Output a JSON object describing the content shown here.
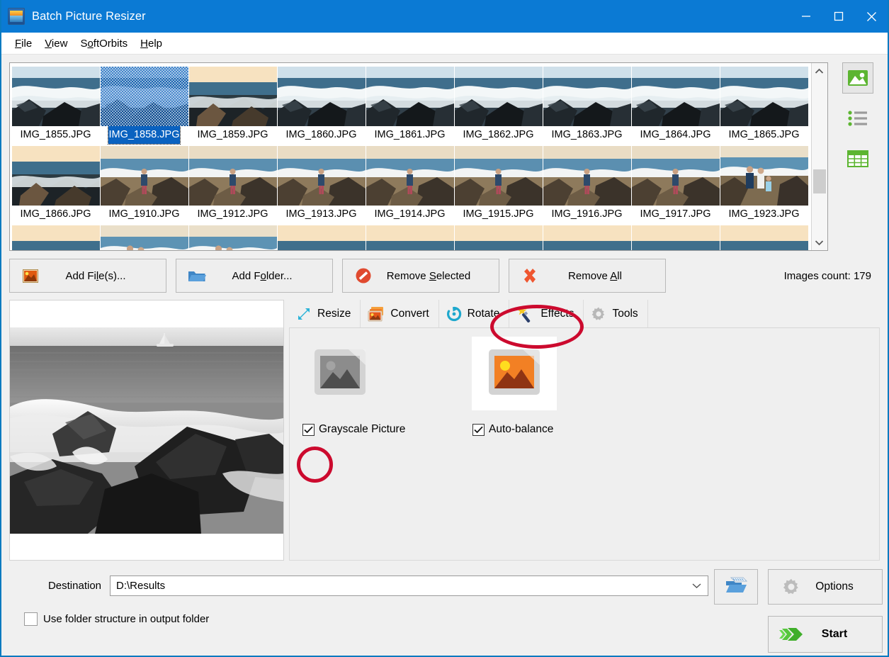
{
  "window": {
    "title": "Batch Picture Resizer",
    "app_icon": "picture-icon",
    "minimize_label": "Minimize",
    "maximize_label": "Maximize",
    "close_label": "Close",
    "accent_color": "#0b7ad4"
  },
  "menu": {
    "items": [
      {
        "label": "File",
        "accel": "F"
      },
      {
        "label": "View",
        "accel": "V"
      },
      {
        "label": "SoftOrbits",
        "accel": ""
      },
      {
        "label": "Help",
        "accel": "H"
      }
    ]
  },
  "thumbnails": {
    "selected": "IMG_1858.JPG",
    "row1": [
      "IMG_1855.JPG",
      "IMG_1858.JPG",
      "IMG_1859.JPG",
      "IMG_1860.JPG",
      "IMG_1861.JPG",
      "IMG_1862.JPG",
      "IMG_1863.JPG",
      "IMG_1864.JPG",
      "IMG_1865.JPG"
    ],
    "row2": [
      "IMG_1866.JPG",
      "IMG_1910.JPG",
      "IMG_1912.JPG",
      "IMG_1913.JPG",
      "IMG_1914.JPG",
      "IMG_1915.JPG",
      "IMG_1916.JPG",
      "IMG_1917.JPG",
      "IMG_1923.JPG"
    ]
  },
  "view_modes": [
    {
      "name": "thumbnail-view",
      "icon": "picture-icon",
      "active": true
    },
    {
      "name": "list-view",
      "icon": "list-icon",
      "active": false
    },
    {
      "name": "details-view",
      "icon": "table-icon",
      "active": false
    }
  ],
  "actions": {
    "add_files": {
      "pre": "Add Fi",
      "accel": "l",
      "post": "e(s)...",
      "icon": "picture-icon"
    },
    "add_folder": {
      "pre": "Add F",
      "accel": "o",
      "post": "lder...",
      "icon": "folder-icon"
    },
    "remove_selected": {
      "pre": "Remove ",
      "accel": "S",
      "post": "elected",
      "icon": "no-entry-icon"
    },
    "remove_all": {
      "pre": "Remove ",
      "accel": "A",
      "post": "ll",
      "icon": "red-x-icon"
    },
    "images_count": "Images count: 179"
  },
  "tabs": [
    {
      "label": "Resize",
      "icon": "resize-arrows-icon",
      "active": false
    },
    {
      "label": "Convert",
      "icon": "convert-stack-icon",
      "active": false
    },
    {
      "label": "Rotate",
      "icon": "rotate-icon",
      "active": false
    },
    {
      "label": "Effects",
      "icon": "magic-wand-icon",
      "active": true
    },
    {
      "label": "Tools",
      "icon": "gear-icon",
      "active": false
    }
  ],
  "effects": {
    "grayscale_label": "Grayscale Picture",
    "grayscale_checked": true,
    "grayscale_icon": "grayscale-photo-icon",
    "autobalance_label": "Auto-balance",
    "autobalance_checked": true,
    "autobalance_icon": "color-photo-icon"
  },
  "destination": {
    "label": "Destination",
    "value": "D:\\Results",
    "placeholder": "",
    "browse_icon": "open-folder-icon",
    "folder_structure_label": "Use folder structure in output folder",
    "folder_structure_checked": false
  },
  "footer": {
    "options_label": "Options",
    "options_icon": "gear-icon",
    "start_label": "Start",
    "start_icon": "green-arrow-icon"
  },
  "annotations": {
    "color": "#cc0a2e",
    "items": [
      {
        "name": "effects-tab-highlight"
      },
      {
        "name": "grayscale-checkbox-highlight"
      }
    ]
  },
  "preview": {
    "alt": "Grayscale seascape with rocks, waves and sailboat"
  }
}
